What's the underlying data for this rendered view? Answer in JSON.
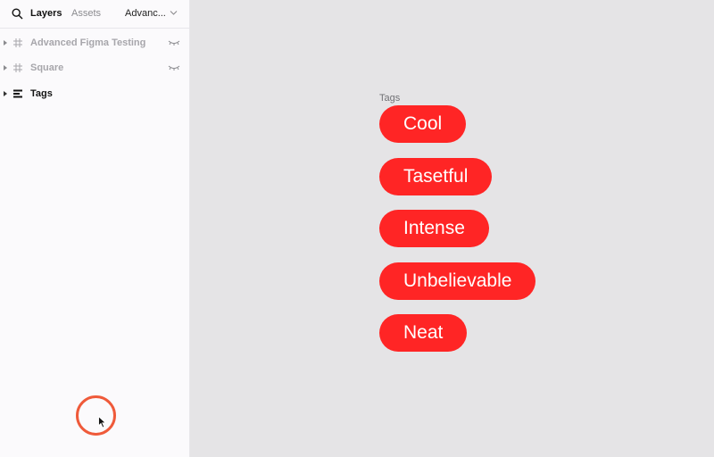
{
  "sidebar": {
    "tabs": {
      "layers": "Layers",
      "assets": "Assets"
    },
    "page_select": "Advanc...",
    "layers": [
      {
        "label": "Advanced Figma Testing",
        "icon": "frame-icon",
        "hidden": true
      },
      {
        "label": "Square",
        "icon": "frame-icon",
        "hidden": true
      },
      {
        "label": "Tags",
        "icon": "auto-layout-icon",
        "hidden": false
      }
    ]
  },
  "canvas": {
    "frame_title": "Tags",
    "tags": [
      "Cool",
      "Tasetful",
      "Intense",
      "Unbelievable",
      "Neat"
    ],
    "tag_color": "#ff2525"
  },
  "colors": {
    "sidebar_bg": "#fbfafc",
    "canvas_bg": "#e5e4e6",
    "click_ring": "#ef5a3a"
  }
}
